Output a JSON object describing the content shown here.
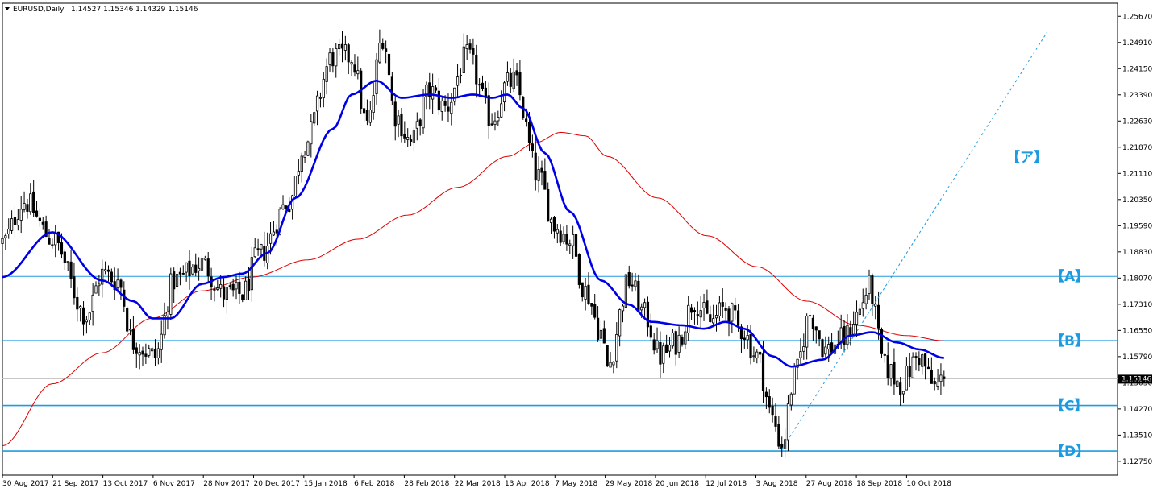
{
  "header": {
    "symbol": "EURUSD,Daily",
    "ohlc": "1.14527 1.15346 1.14329 1.15146"
  },
  "colors": {
    "candle": "#000000",
    "ma_fast": "#0000e6",
    "ma_slow": "#e00000",
    "level_line": "#1e9be0",
    "label": "#1e9be0",
    "current_line": "#c0c0c0",
    "price_tag_bg": "#000000"
  },
  "chart_data": {
    "type": "candlestick",
    "ylim": [
      1.1235,
      1.2605
    ],
    "xlim": [
      "2017-08-30",
      "2018-12-12"
    ],
    "y_ticks": [
      "1.25670",
      "1.24910",
      "1.24150",
      "1.23390",
      "1.22630",
      "1.21870",
      "1.21110",
      "1.20350",
      "1.19590",
      "1.18830",
      "1.18070",
      "1.17310",
      "1.16550",
      "1.15790",
      "1.15030",
      "1.14270",
      "1.13510",
      "1.12750"
    ],
    "x_ticks": [
      {
        "date": "2017-08-30",
        "label": "30 Aug 2017"
      },
      {
        "date": "2017-09-21",
        "label": "21 Sep 2017"
      },
      {
        "date": "2017-10-13",
        "label": "13 Oct 2017"
      },
      {
        "date": "2017-11-06",
        "label": "6 Nov 2017"
      },
      {
        "date": "2017-11-28",
        "label": "28 Nov 2017"
      },
      {
        "date": "2017-12-20",
        "label": "20 Dec 2017"
      },
      {
        "date": "2018-01-15",
        "label": "15 Jan 2018"
      },
      {
        "date": "2018-02-06",
        "label": "6 Feb 2018"
      },
      {
        "date": "2018-02-28",
        "label": "28 Feb 2018"
      },
      {
        "date": "2018-03-22",
        "label": "22 Mar 2018"
      },
      {
        "date": "2018-04-13",
        "label": "13 Apr 2018"
      },
      {
        "date": "2018-05-07",
        "label": "7 May 2018"
      },
      {
        "date": "2018-05-29",
        "label": "29 May 2018"
      },
      {
        "date": "2018-06-20",
        "label": "20 Jun 2018"
      },
      {
        "date": "2018-07-12",
        "label": "12 Jul 2018"
      },
      {
        "date": "2018-08-03",
        "label": "3 Aug 2018"
      },
      {
        "date": "2018-08-27",
        "label": "27 Aug 2018"
      },
      {
        "date": "2018-09-18",
        "label": "18 Sep 2018"
      },
      {
        "date": "2018-10-10",
        "label": "10 Oct 2018"
      }
    ],
    "current_price": "1.15146",
    "close_anchors": [
      [
        "2017-08-30",
        1.191
      ],
      [
        "2017-09-08",
        1.203
      ],
      [
        "2017-09-21",
        1.192
      ],
      [
        "2017-10-06",
        1.17
      ],
      [
        "2017-10-13",
        1.182
      ],
      [
        "2017-10-20",
        1.18
      ],
      [
        "2017-10-27",
        1.162
      ],
      [
        "2017-11-07",
        1.158
      ],
      [
        "2017-11-15",
        1.18
      ],
      [
        "2017-11-28",
        1.185
      ],
      [
        "2017-12-07",
        1.176
      ],
      [
        "2017-12-15",
        1.176
      ],
      [
        "2017-12-22",
        1.187
      ],
      [
        "2018-01-05",
        1.203
      ],
      [
        "2018-01-12",
        1.22
      ],
      [
        "2018-01-25",
        1.245
      ],
      [
        "2018-02-02",
        1.245
      ],
      [
        "2018-02-09",
        1.225
      ],
      [
        "2018-02-16",
        1.251
      ],
      [
        "2018-02-22",
        1.228
      ],
      [
        "2018-03-01",
        1.22
      ],
      [
        "2018-03-09",
        1.235
      ],
      [
        "2018-03-16",
        1.23
      ],
      [
        "2018-03-27",
        1.245
      ],
      [
        "2018-04-06",
        1.227
      ],
      [
        "2018-04-13",
        1.237
      ],
      [
        "2018-04-17",
        1.238
      ],
      [
        "2018-04-27",
        1.21
      ],
      [
        "2018-05-04",
        1.196
      ],
      [
        "2018-05-11",
        1.192
      ],
      [
        "2018-05-18",
        1.177
      ],
      [
        "2018-05-25",
        1.165
      ],
      [
        "2018-05-29",
        1.155
      ],
      [
        "2018-06-07",
        1.18
      ],
      [
        "2018-06-14",
        1.17
      ],
      [
        "2018-06-21",
        1.158
      ],
      [
        "2018-06-28",
        1.162
      ],
      [
        "2018-07-06",
        1.174
      ],
      [
        "2018-07-13",
        1.168
      ],
      [
        "2018-07-20",
        1.172
      ],
      [
        "2018-07-27",
        1.166
      ],
      [
        "2018-08-03",
        1.158
      ],
      [
        "2018-08-10",
        1.14
      ],
      [
        "2018-08-15",
        1.132
      ],
      [
        "2018-08-21",
        1.152
      ],
      [
        "2018-08-28",
        1.17
      ],
      [
        "2018-09-04",
        1.16
      ],
      [
        "2018-09-12",
        1.163
      ],
      [
        "2018-09-18",
        1.17
      ],
      [
        "2018-09-24",
        1.178
      ],
      [
        "2018-10-01",
        1.155
      ],
      [
        "2018-10-08",
        1.15
      ],
      [
        "2018-10-16",
        1.158
      ],
      [
        "2018-10-23",
        1.149
      ],
      [
        "2018-10-26",
        1.1515
      ]
    ],
    "ma_fast_anchors": [
      [
        "2017-08-30",
        1.181
      ],
      [
        "2017-09-21",
        1.194
      ],
      [
        "2017-10-13",
        1.18
      ],
      [
        "2017-10-27",
        1.174
      ],
      [
        "2017-11-05",
        1.169
      ],
      [
        "2017-11-14",
        1.169
      ],
      [
        "2017-11-28",
        1.179
      ],
      [
        "2017-12-07",
        1.181
      ],
      [
        "2017-12-15",
        1.182
      ],
      [
        "2017-12-27",
        1.188
      ],
      [
        "2018-01-09",
        1.204
      ],
      [
        "2018-01-25",
        1.224
      ],
      [
        "2018-02-02",
        1.234
      ],
      [
        "2018-02-14",
        1.238
      ],
      [
        "2018-02-26",
        1.233
      ],
      [
        "2018-03-09",
        1.234
      ],
      [
        "2018-03-20",
        1.233
      ],
      [
        "2018-03-29",
        1.234
      ],
      [
        "2018-04-06",
        1.233
      ],
      [
        "2018-04-13",
        1.234
      ],
      [
        "2018-04-20",
        1.23
      ],
      [
        "2018-05-01",
        1.217
      ],
      [
        "2018-05-11",
        1.2
      ],
      [
        "2018-05-25",
        1.18
      ],
      [
        "2018-06-07",
        1.173
      ],
      [
        "2018-06-18",
        1.168
      ],
      [
        "2018-07-02",
        1.167
      ],
      [
        "2018-07-11",
        1.166
      ],
      [
        "2018-07-20",
        1.168
      ],
      [
        "2018-07-30",
        1.166
      ],
      [
        "2018-08-10",
        1.158
      ],
      [
        "2018-08-20",
        1.155
      ],
      [
        "2018-09-03",
        1.157
      ],
      [
        "2018-09-14",
        1.164
      ],
      [
        "2018-09-25",
        1.165
      ],
      [
        "2018-10-05",
        1.162
      ],
      [
        "2018-10-16",
        1.16
      ],
      [
        "2018-10-26",
        1.1575
      ]
    ],
    "ma_slow_anchors": [
      [
        "2017-08-30",
        1.132
      ],
      [
        "2017-09-21",
        1.15
      ],
      [
        "2017-10-13",
        1.159
      ],
      [
        "2017-11-06",
        1.169
      ],
      [
        "2017-11-28",
        1.177
      ],
      [
        "2017-12-20",
        1.181
      ],
      [
        "2018-01-15",
        1.186
      ],
      [
        "2018-02-06",
        1.192
      ],
      [
        "2018-02-28",
        1.199
      ],
      [
        "2018-03-22",
        1.207
      ],
      [
        "2018-04-13",
        1.216
      ],
      [
        "2018-04-26",
        1.22
      ],
      [
        "2018-05-08",
        1.223
      ],
      [
        "2018-05-18",
        1.222
      ],
      [
        "2018-05-29",
        1.216
      ],
      [
        "2018-06-20",
        1.204
      ],
      [
        "2018-07-12",
        1.193
      ],
      [
        "2018-08-03",
        1.184
      ],
      [
        "2018-08-27",
        1.174
      ],
      [
        "2018-09-18",
        1.167
      ],
      [
        "2018-10-10",
        1.164
      ],
      [
        "2018-10-26",
        1.1625
      ]
    ],
    "levels": [
      {
        "label": "【A】",
        "price": 1.1812
      },
      {
        "label": "【B】",
        "price": 1.1625
      },
      {
        "label": "【C】",
        "price": 1.1437
      },
      {
        "label": "【D】",
        "price": 1.1305
      }
    ],
    "trendline": {
      "label": "【ア】",
      "start": [
        "2018-08-15",
        1.131
      ],
      "end": [
        "2018-12-12",
        1.252
      ]
    }
  }
}
